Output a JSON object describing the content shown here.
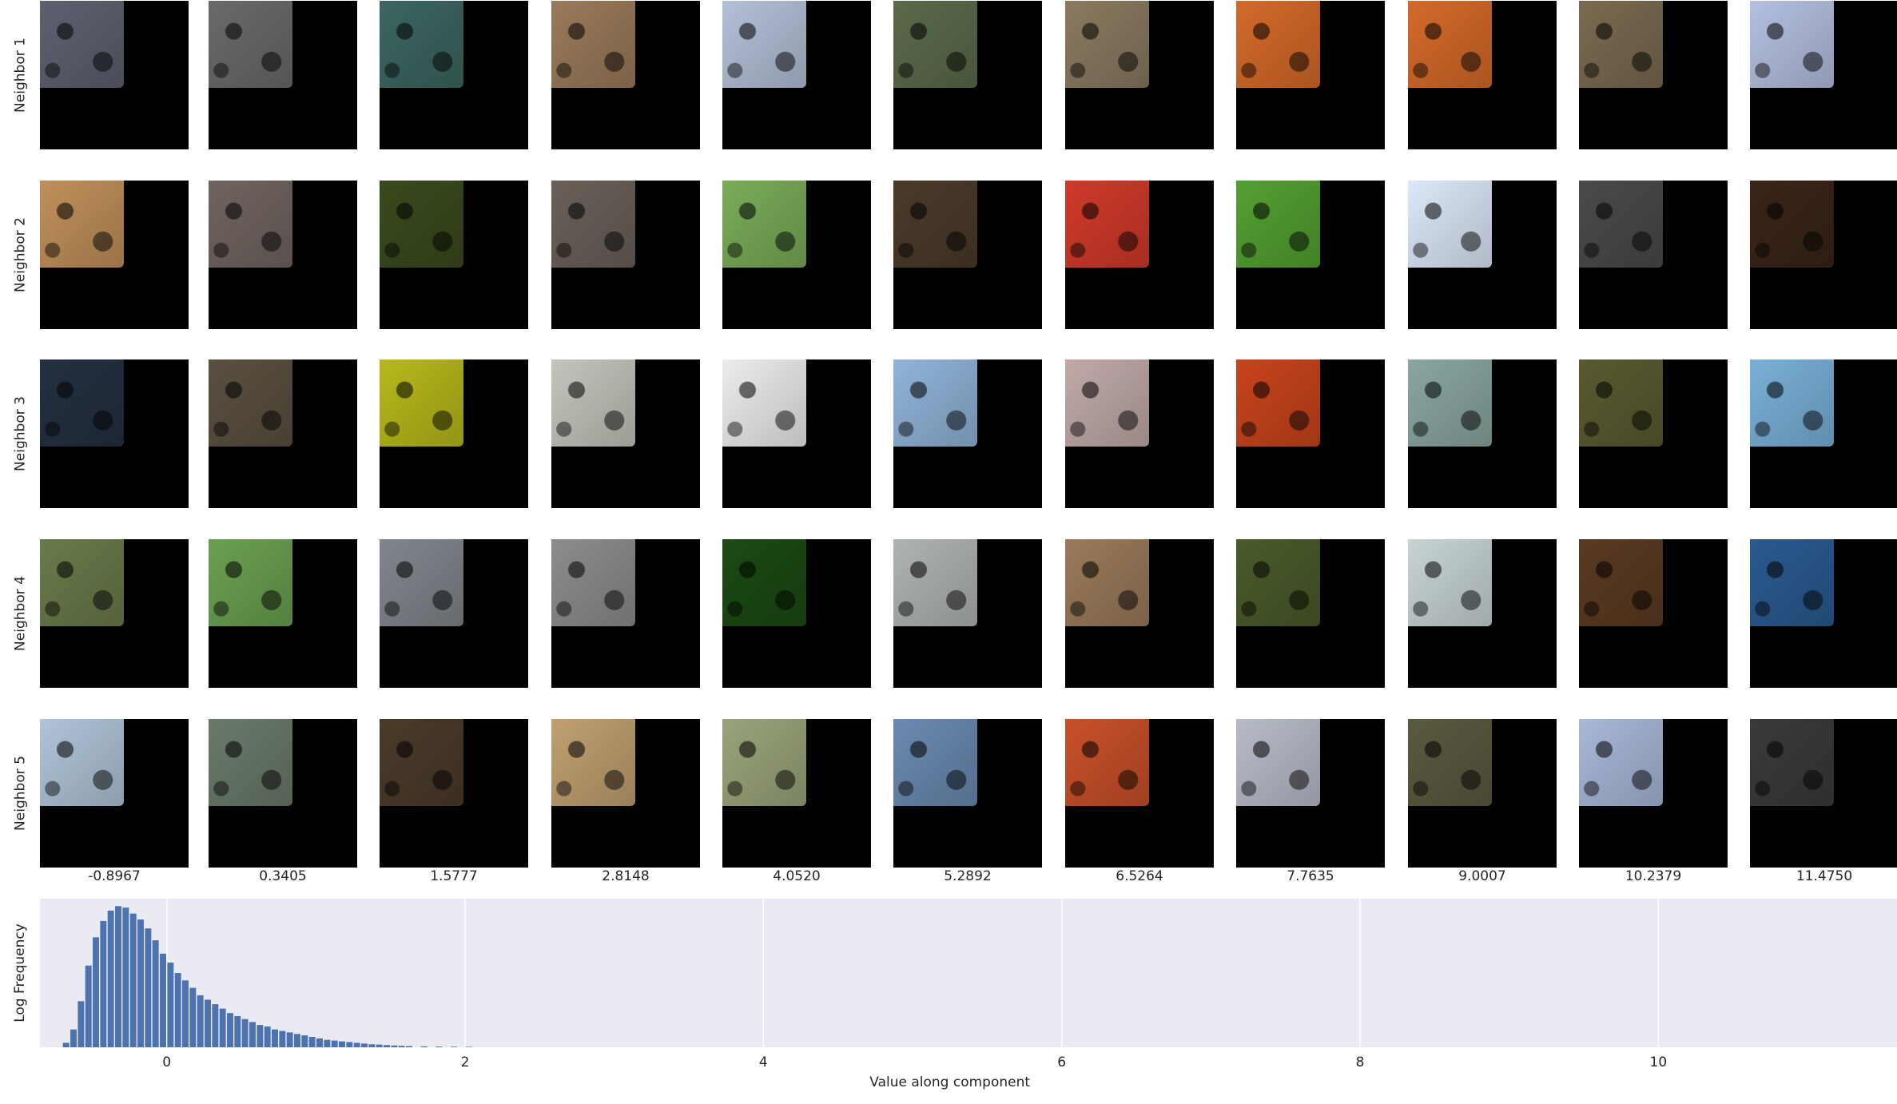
{
  "rows": [
    {
      "label": "Neighbor 1",
      "patches": [
        "#5e6070",
        "#6a6a6a",
        "#3c6660",
        "#9a7a5a",
        "#b4c0d8",
        "#5a6a4a",
        "#8a7a60",
        "#d46a2a",
        "#d46a2a",
        "#7a6a50",
        "#b4c0e0"
      ]
    },
    {
      "label": "Neighbor 2",
      "patches": [
        "#c0905a",
        "#706460",
        "#3a4a1c",
        "#6a6058",
        "#7aac58",
        "#4a3a2a",
        "#d03a2a",
        "#54a032",
        "#dce8f8",
        "#4a4a4a",
        "#3a2418"
      ]
    },
    {
      "label": "Neighbor 3",
      "patches": [
        "#243040",
        "#5a5040",
        "#b8b81c",
        "#c4c4bc",
        "#ececec",
        "#90b4d8",
        "#c0aaa8",
        "#c8441c",
        "#8aa6a0",
        "#5a5a30",
        "#7ab0d8"
      ]
    },
    {
      "label": "Neighbor 4",
      "patches": [
        "#6a7a4a",
        "#6aa050",
        "#80868c",
        "#8c8c8c",
        "#1c4a14",
        "#b0b4b0",
        "#9a7a5a",
        "#4a5a2a",
        "#c8d4d4",
        "#5a3a22",
        "#2a5a90"
      ]
    },
    {
      "label": "Neighbor 5",
      "patches": [
        "#b0c4d8",
        "#6a7a6a",
        "#4a3a2a",
        "#c0a070",
        "#9aa47a",
        "#6a8ab0",
        "#c8502a",
        "#b8bcc8",
        "#5a5a40",
        "#a8b8d8",
        "#3a3a3a"
      ]
    }
  ],
  "column_values": [
    "-0.8967",
    "0.3405",
    "1.5777",
    "2.8148",
    "4.0520",
    "5.2892",
    "6.5264",
    "7.7635",
    "9.0007",
    "10.2379",
    "11.4750"
  ],
  "chart_data": {
    "type": "bar",
    "xlabel": "Value along component",
    "ylabel": "Log Frequency",
    "xticks": [
      0,
      2,
      4,
      6,
      8,
      10
    ],
    "xlim": [
      -0.85,
      11.6
    ],
    "bin_width": 0.05,
    "grid": true,
    "colors": {
      "bars": "#4c72b0",
      "background": "#eaeaf2",
      "grid": "#ffffff"
    },
    "bins": [
      {
        "x": -0.7,
        "value": 0.03
      },
      {
        "x": -0.65,
        "value": 0.12
      },
      {
        "x": -0.6,
        "value": 0.31
      },
      {
        "x": -0.55,
        "value": 0.55
      },
      {
        "x": -0.5,
        "value": 0.74
      },
      {
        "x": -0.45,
        "value": 0.85
      },
      {
        "x": -0.4,
        "value": 0.92
      },
      {
        "x": -0.35,
        "value": 0.95
      },
      {
        "x": -0.3,
        "value": 0.94
      },
      {
        "x": -0.25,
        "value": 0.9
      },
      {
        "x": -0.2,
        "value": 0.86
      },
      {
        "x": -0.15,
        "value": 0.8
      },
      {
        "x": -0.1,
        "value": 0.72
      },
      {
        "x": -0.05,
        "value": 0.63
      },
      {
        "x": 0.0,
        "value": 0.57
      },
      {
        "x": 0.05,
        "value": 0.5
      },
      {
        "x": 0.1,
        "value": 0.45
      },
      {
        "x": 0.15,
        "value": 0.4
      },
      {
        "x": 0.2,
        "value": 0.35
      },
      {
        "x": 0.25,
        "value": 0.32
      },
      {
        "x": 0.3,
        "value": 0.29
      },
      {
        "x": 0.35,
        "value": 0.26
      },
      {
        "x": 0.4,
        "value": 0.23
      },
      {
        "x": 0.45,
        "value": 0.21
      },
      {
        "x": 0.5,
        "value": 0.19
      },
      {
        "x": 0.55,
        "value": 0.17
      },
      {
        "x": 0.6,
        "value": 0.15
      },
      {
        "x": 0.65,
        "value": 0.14
      },
      {
        "x": 0.7,
        "value": 0.12
      },
      {
        "x": 0.75,
        "value": 0.11
      },
      {
        "x": 0.8,
        "value": 0.1
      },
      {
        "x": 0.85,
        "value": 0.09
      },
      {
        "x": 0.9,
        "value": 0.08
      },
      {
        "x": 0.95,
        "value": 0.07
      },
      {
        "x": 1.0,
        "value": 0.06
      },
      {
        "x": 1.05,
        "value": 0.05
      },
      {
        "x": 1.1,
        "value": 0.045
      },
      {
        "x": 1.15,
        "value": 0.04
      },
      {
        "x": 1.2,
        "value": 0.035
      },
      {
        "x": 1.25,
        "value": 0.03
      },
      {
        "x": 1.3,
        "value": 0.025
      },
      {
        "x": 1.35,
        "value": 0.02
      },
      {
        "x": 1.4,
        "value": 0.018
      },
      {
        "x": 1.45,
        "value": 0.015
      },
      {
        "x": 1.5,
        "value": 0.012
      },
      {
        "x": 1.55,
        "value": 0.01
      },
      {
        "x": 1.6,
        "value": 0.008
      },
      {
        "x": 1.7,
        "value": 0.006
      },
      {
        "x": 1.8,
        "value": 0.005
      },
      {
        "x": 1.9,
        "value": 0.004
      },
      {
        "x": 2.0,
        "value": 0.003
      }
    ]
  }
}
